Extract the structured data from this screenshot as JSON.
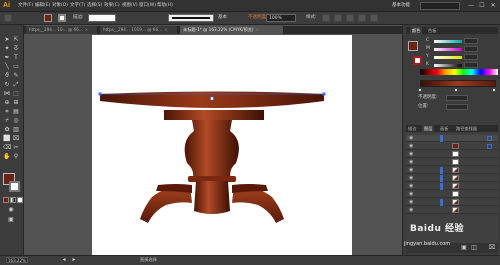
{
  "app": {
    "logo": "Ai"
  },
  "menu": [
    "文件(F)",
    "编辑(E)",
    "对象(O)",
    "文字(T)",
    "选择(S)",
    "效果(C)",
    "视图(V)",
    "窗口(W)",
    "帮助(H)"
  ],
  "workspace": "基本功能",
  "window_buttons": [
    "—",
    "☐",
    "✕"
  ],
  "control_bar": {
    "stroke_label": "描边:",
    "brush_label": "基本",
    "opacity_label": "不透明度:",
    "opacity_value": "100%",
    "style_label": "样式:"
  },
  "tabs": [
    {
      "label": "https__294... 10... @ 66...",
      "active": false
    },
    {
      "label": "https__294... 1019... @ 66...",
      "active": false
    },
    {
      "label": "未标题-1* @ 163.22% (CMYK/预览)",
      "active": true
    }
  ],
  "colors": {
    "fill": "#6b2414",
    "wood_dark": "#4a1406",
    "wood_mid": "#8a2f14",
    "wood_light": "#b24a26",
    "accent_select": "#3b6fd6"
  },
  "status": {
    "zoom": "163.22%",
    "text": "直接选择"
  },
  "panels": {
    "top_tabs": [
      "颜色",
      "色板"
    ],
    "mid_tabs": [
      "渐变",
      "透明度"
    ],
    "layers_tabs": [
      "描边",
      "图层",
      "画板",
      "路径查找器"
    ],
    "gradient_opacity_label": "不透明度:",
    "gradient_location_label": "位置:"
  },
  "watermark": {
    "text": "Baidu 经验",
    "url": "jingyan.baidu.com"
  }
}
